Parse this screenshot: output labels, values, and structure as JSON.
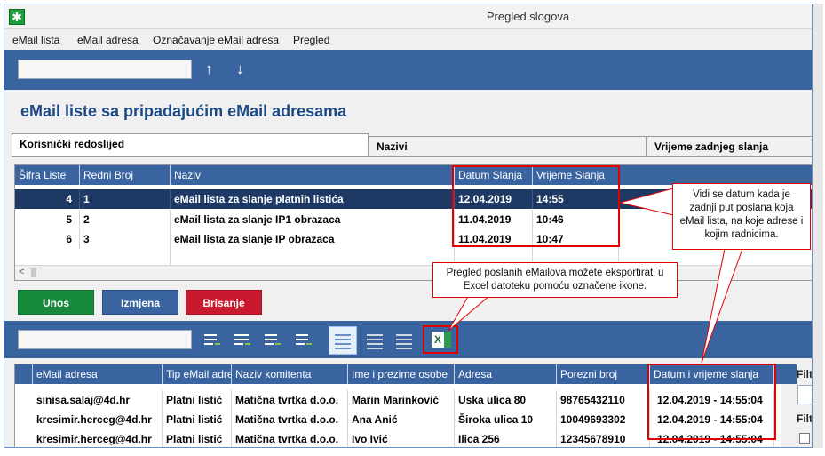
{
  "window": {
    "title": "Pregled slogova",
    "app_icon": "green-star-icon"
  },
  "menu": [
    {
      "label": "eMail lista"
    },
    {
      "label": "eMail adresa"
    },
    {
      "label": "Označavanje eMail adresa"
    },
    {
      "label": "Pregled"
    }
  ],
  "toolbar_top": {
    "search_value": "",
    "up_icon": "↑",
    "down_icon": "↓"
  },
  "heading": "eMail liste sa pripadajućim eMail adresama",
  "tabs": [
    {
      "label": "Korisnički redoslijed",
      "active": true
    },
    {
      "label": "Nazivi",
      "active": false
    },
    {
      "label": "Vrijeme zadnjeg slanja",
      "active": false
    }
  ],
  "top_grid": {
    "columns": [
      "Šifra Liste",
      "Redni Broj",
      "Naziv",
      "Datum Slanja",
      "Vrijeme Slanja"
    ],
    "rows": [
      {
        "sifra": "4",
        "redni": "1",
        "naziv": "eMail lista za slanje platnih listića",
        "datum": "12.04.2019",
        "vrijeme": "14:55",
        "selected": true
      },
      {
        "sifra": "5",
        "redni": "2",
        "naziv": "eMail lista za slanje IP1 obrazaca",
        "datum": "11.04.2019",
        "vrijeme": "10:46",
        "selected": false
      },
      {
        "sifra": "6",
        "redni": "3",
        "naziv": "eMail lista za slanje IP obrazaca",
        "datum": "11.04.2019",
        "vrijeme": "10:47",
        "selected": false
      }
    ],
    "scroll_left": "<"
  },
  "buttons": {
    "unos": "Unos",
    "izmjena": "Izmjena",
    "brisanje": "Brisanje"
  },
  "colors": {
    "blue": "#3a64a0",
    "green_button": "#188a3c",
    "blue_button": "#3a64a0",
    "red_button": "#c8192e",
    "highlight_red": "#e00000"
  },
  "bottom_toolbar": {
    "search_value": "",
    "icons": [
      "add-to-list-icon",
      "move-list-icon",
      "remove-from-list-icon",
      "refresh-list-icon",
      "list-view-icon",
      "list-compact-icon",
      "list-dense-icon",
      "excel-export-icon"
    ],
    "excel_label": "X"
  },
  "bottom_grid": {
    "columns": [
      "eMail adresa",
      "Tip eMail adre",
      "Naziv komitenta",
      "Ime i prezime osobe",
      "Adresa",
      "Porezni broj",
      "Datum i vrijeme slanja"
    ],
    "rows": [
      {
        "email": "sinisa.salaj@4d.hr",
        "tip": "Platni listić",
        "komitent": "Matična tvrtka d.o.o.",
        "osoba": "Marin Marinković",
        "adresa": "Uska ulica 80",
        "porezni": "98765432110",
        "datum": "12.04.2019 - 14:55:04"
      },
      {
        "email": "kresimir.herceg@4d.hr",
        "tip": "Platni listić",
        "komitent": "Matična tvrtka d.o.o.",
        "osoba": "Ana Anić",
        "adresa": "Široka ulica 10",
        "porezni": "10049693302",
        "datum": "12.04.2019 - 14:55:04"
      },
      {
        "email": "kresimir.herceg@4d.hr",
        "tip": "Platni listić",
        "komitent": "Matična tvrtka d.o.o.",
        "osoba": "Ivo Ivić",
        "adresa": "Ilica 256",
        "porezni": "12345678910",
        "datum": "12.04.2019 - 14:55:04"
      }
    ]
  },
  "side_panel": {
    "filter1": "Filte",
    "filter2": "Filte"
  },
  "callouts": {
    "date_note": "Vidi se datum kada je zadnji put poslana koja eMail lista, na koje adrese i kojim radnicima.",
    "excel_note": "Pregled poslanih eMailova možete eksportirati u Excel datoteku pomoću označene ikone."
  }
}
